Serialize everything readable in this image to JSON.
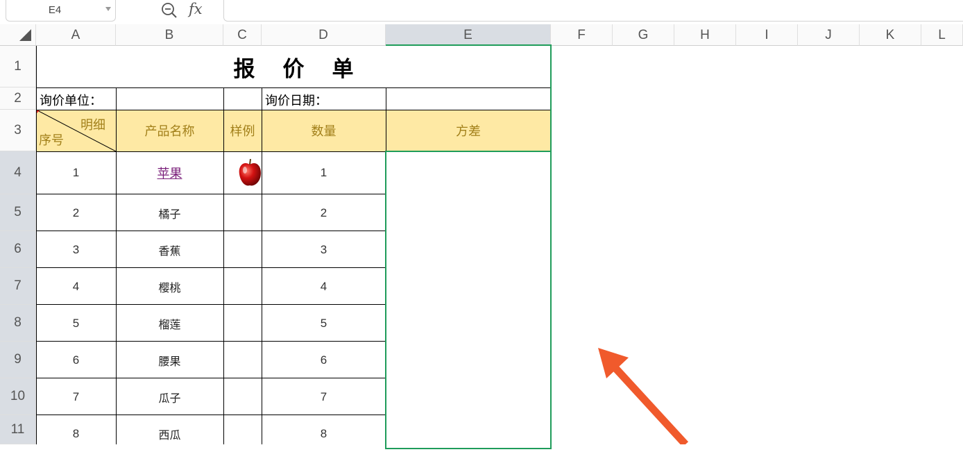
{
  "formula_bar": {
    "name_box": "E4",
    "fx_label": "fx",
    "formula": ""
  },
  "columns": [
    "A",
    "B",
    "C",
    "D",
    "E",
    "F",
    "G",
    "H",
    "I",
    "J",
    "K",
    "L"
  ],
  "selected_column": "E",
  "rows": [
    "1",
    "2",
    "3",
    "4",
    "5",
    "6",
    "7",
    "8",
    "9",
    "10",
    "11"
  ],
  "sheet": {
    "title": "报价单",
    "inquiry_unit_label": "询价单位：",
    "inquiry_date_label": "询价日期：",
    "header": {
      "diag_top": "明细",
      "diag_bottom": "序号",
      "product_name": "产品名称",
      "sample": "样例",
      "quantity": "数量",
      "variance": "方差"
    },
    "items": [
      {
        "no": "1",
        "name": "苹果",
        "qty": "1"
      },
      {
        "no": "2",
        "name": "橘子",
        "qty": "2"
      },
      {
        "no": "3",
        "name": "香蕉",
        "qty": "3"
      },
      {
        "no": "4",
        "name": "樱桃",
        "qty": "4"
      },
      {
        "no": "5",
        "name": "榴莲",
        "qty": "5"
      },
      {
        "no": "6",
        "name": "腰果",
        "qty": "6"
      },
      {
        "no": "7",
        "name": "瓜子",
        "qty": "7"
      },
      {
        "no": "8",
        "name": "西瓜",
        "qty": "8"
      }
    ]
  },
  "colors": {
    "header_fill": "#fee9a4",
    "selection": "#1e9c5a",
    "arrow": "#f05a2c",
    "hyperlink": "#7a1f7a"
  },
  "icons": [
    "zoom-icon",
    "fx-icon",
    "apple-image",
    "arrow-annotation"
  ]
}
